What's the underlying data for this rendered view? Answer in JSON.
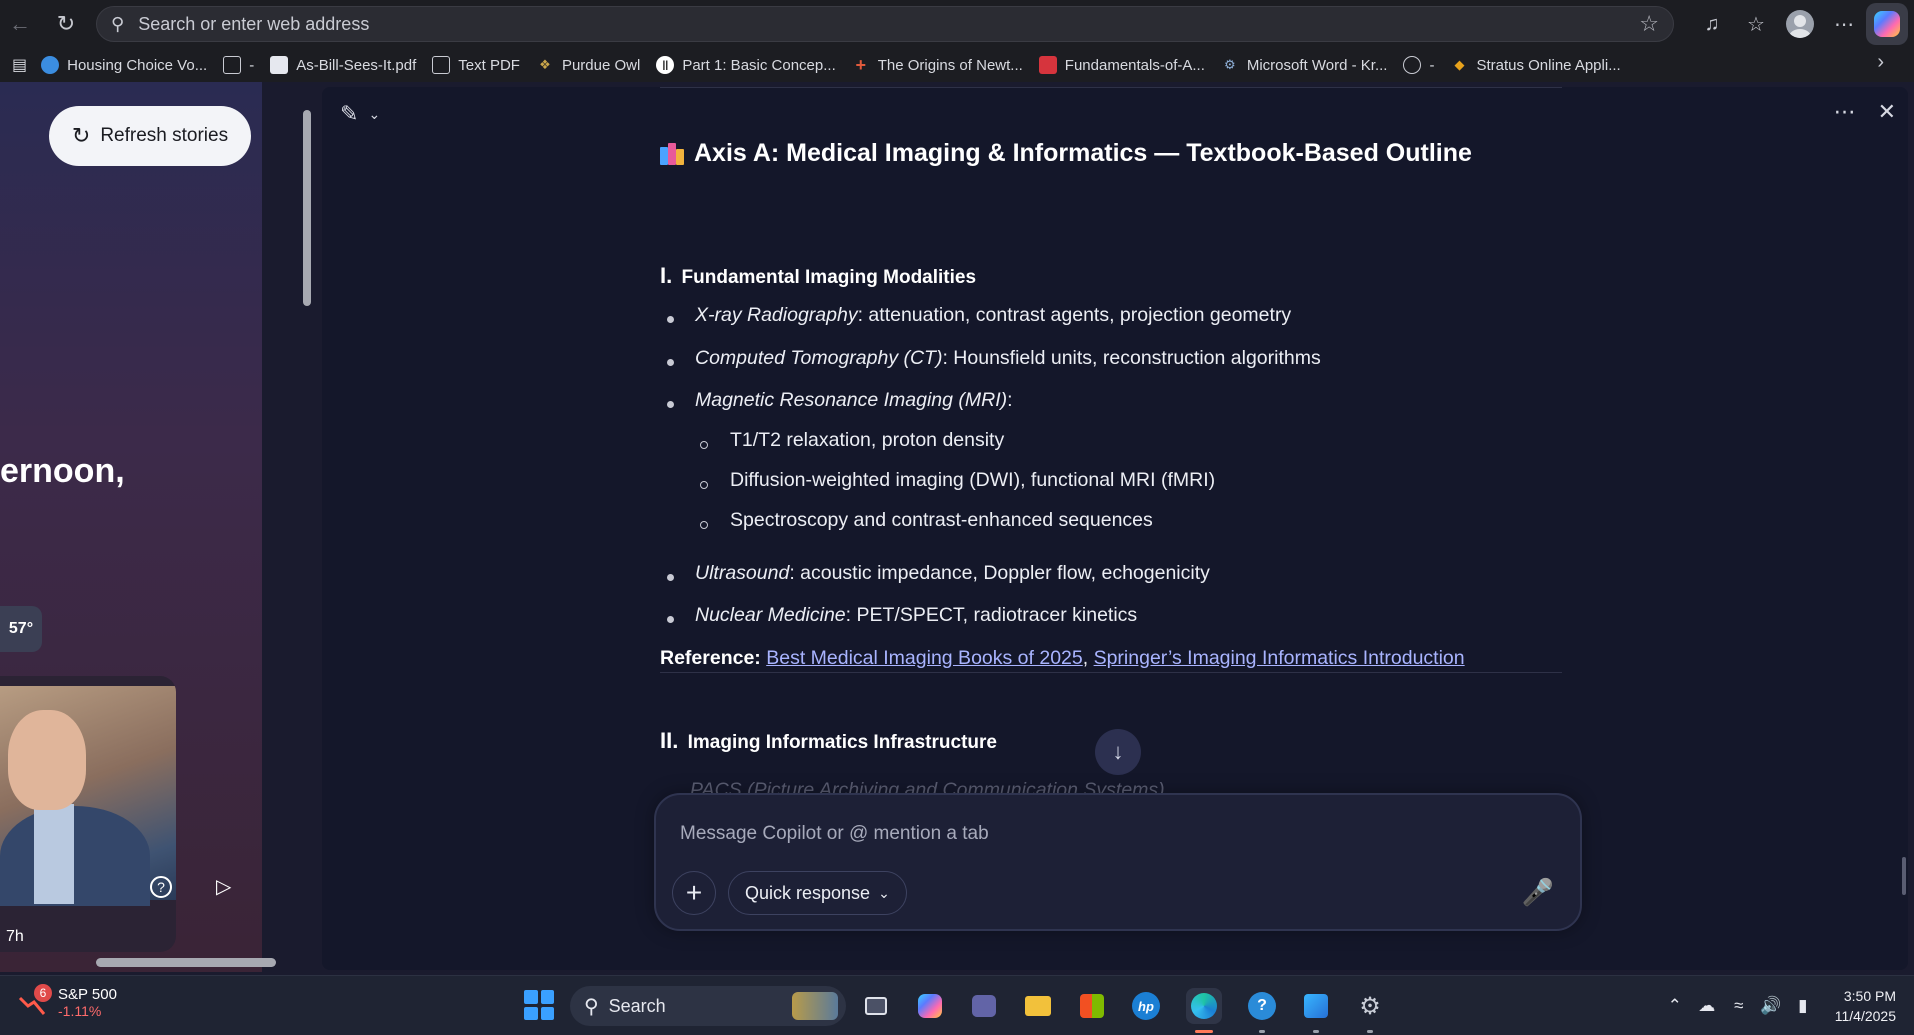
{
  "browser": {
    "address_placeholder": "Search or enter web address",
    "bookmarks": [
      {
        "label": "Housing Choice Vo...",
        "icon": "globe-icon",
        "color": "#3b8de0"
      },
      {
        "label": "-",
        "icon": "folder-icon",
        "color": "#c9cbd3"
      },
      {
        "label": "As-Bill-Sees-It.pdf",
        "icon": "pdf-icon",
        "color": "#e6e8ef"
      },
      {
        "label": "Text PDF",
        "icon": "folder-icon",
        "color": "#c9cbd3"
      },
      {
        "label": "Purdue Owl",
        "icon": "owl-icon",
        "color": "#c9a54a"
      },
      {
        "label": "Part 1: Basic Concep...",
        "icon": "pause-icon",
        "color": "#ffffff"
      },
      {
        "label": "The Origins of Newt...",
        "icon": "plus-icon",
        "color": "#e05a3c"
      },
      {
        "label": "Fundamentals-of-A...",
        "icon": "pdf-red-icon",
        "color": "#d6343d"
      },
      {
        "label": "Microsoft Word - Kr...",
        "icon": "gear-icon",
        "color": "#8fb0d8"
      },
      {
        "label": "-",
        "icon": "globe-icon",
        "color": "#c9cbd3"
      },
      {
        "label": "Stratus Online Appli...",
        "icon": "flame-icon",
        "color": "#e7a21c"
      }
    ]
  },
  "news": {
    "refresh_label": "Refresh stories",
    "greeting": "ernoon,",
    "temperature": "57°",
    "story_time": "7h"
  },
  "copilot": {
    "title": "Axis A: Medical Imaging & Informatics — Textbook-Based Outline",
    "section1": {
      "numeral": "I.",
      "heading": "Fundamental Imaging Modalities",
      "items": [
        {
          "term": "X-ray Radiography",
          "desc": ": attenuation, contrast agents, projection geometry"
        },
        {
          "term": "Computed Tomography (CT)",
          "desc": ": Hounsfield units, reconstruction algorithms"
        },
        {
          "term": "Magnetic Resonance Imaging (MRI)",
          "desc": ":"
        },
        {
          "term": "Ultrasound",
          "desc": ": acoustic impedance, Doppler flow, echogenicity"
        },
        {
          "term": "Nuclear Medicine",
          "desc": ": PET/SPECT, radiotracer kinetics"
        }
      ],
      "mri_subitems": [
        "T1/T2 relaxation, proton density",
        "Diffusion-weighted imaging (DWI), functional MRI (fMRI)",
        "Spectroscopy and contrast-enhanced sequences"
      ]
    },
    "reference_label": "Reference:",
    "reference_links": [
      "Best Medical Imaging Books of 2025",
      "Springer’s Imaging Informatics Introduction"
    ],
    "reference_sep": ",",
    "section2": {
      "numeral": "II.",
      "heading": "Imaging Informatics Infrastructure",
      "first_item": "PACS (Picture Archiving and Communication Systems)"
    },
    "composer_placeholder": "Message Copilot or @ mention a tab",
    "mode_label": "Quick response"
  },
  "taskbar": {
    "stock_badge": "6",
    "stock_name": "S&P 500",
    "stock_change": "-1.11%",
    "search_label": "Search",
    "time": "3:50 PM",
    "date": "11/4/2025"
  },
  "colors": {
    "accent_link": "#a9b4ff",
    "panel_bg": "#14172a",
    "stock_down": "#ff6b6b"
  }
}
